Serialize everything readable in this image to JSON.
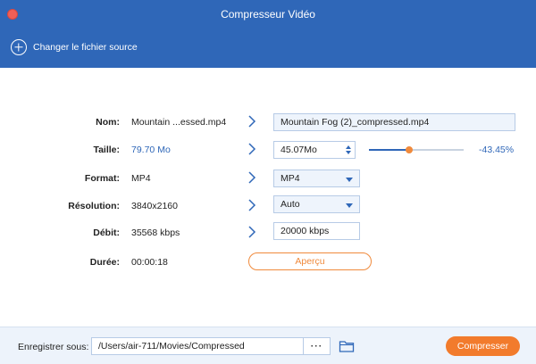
{
  "window": {
    "title": "Compresseur Vidéo"
  },
  "header": {
    "change_source_label": "Changer le fichier source"
  },
  "form": {
    "name": {
      "label": "Nom:",
      "source_value": "Mountain ...essed.mp4",
      "output_value": "Mountain Fog (2)_compressed.mp4"
    },
    "size": {
      "label": "Taille:",
      "source_value": "79.70 Mo",
      "output_value": "45.07Mo",
      "slider_fraction": 0.42,
      "reduction_percent": "-43.45%"
    },
    "format": {
      "label": "Format:",
      "source_value": "MP4",
      "selected": "MP4"
    },
    "resolution": {
      "label": "Résolution:",
      "source_value": "3840x2160",
      "selected": "Auto"
    },
    "bitrate": {
      "label": "Débit:",
      "source_value": "35568 kbps",
      "output_value": "20000 kbps"
    },
    "duration": {
      "label": "Durée:",
      "value": "00:00:18",
      "preview_label": "Aperçu"
    }
  },
  "footer": {
    "save_label": "Enregistrer sous:",
    "path_value": "/Users/air-711/Movies/Compressed",
    "browse_label": "···",
    "compress_label": "Compresser"
  },
  "colors": {
    "accent_blue": "#2f67b8",
    "accent_orange": "#f27b2c",
    "close_red": "#f05f57"
  },
  "icons": {
    "close": "close-icon",
    "add": "plus-circle-icon",
    "arrow": "chevron-right-icon",
    "folder": "folder-icon"
  }
}
